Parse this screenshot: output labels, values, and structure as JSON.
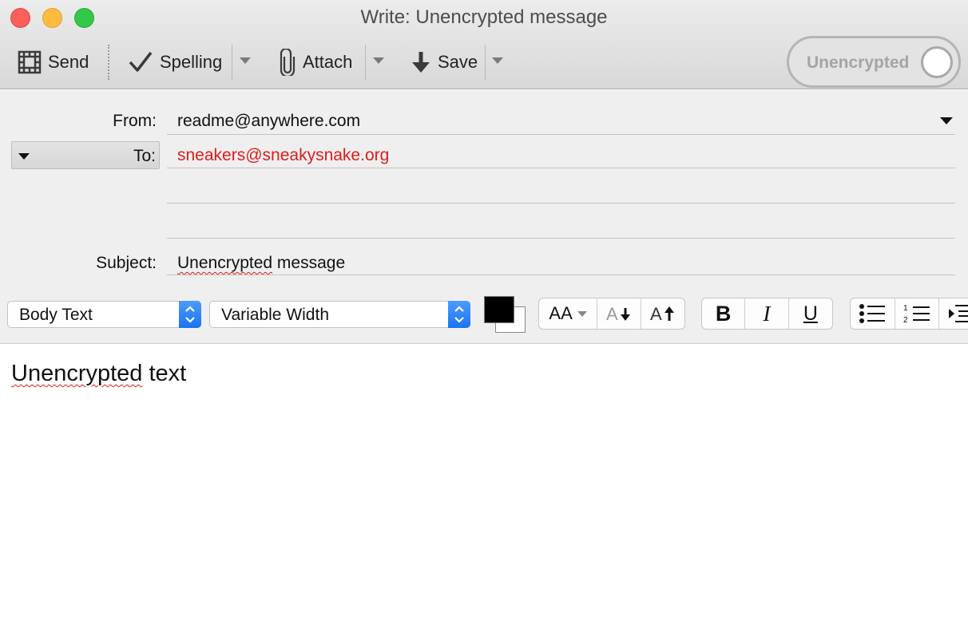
{
  "window": {
    "title": "Write: Unencrypted message"
  },
  "toolbar": {
    "send_label": "Send",
    "spelling_label": "Spelling",
    "attach_label": "Attach",
    "save_label": "Save",
    "encryption_label": "Unencrypted",
    "encryption_enabled": false
  },
  "header": {
    "from_label": "From:",
    "from_value": "readme@anywhere.com",
    "to_label": "To:",
    "to_value": "sneakers@sneakysnake.org",
    "subject_label": "Subject:",
    "subject_value_misspelled": "Unencrypted",
    "subject_value_rest": " message"
  },
  "format_bar": {
    "paragraph_style": "Body Text",
    "font": "Variable Width",
    "text_color": "#000000",
    "background_color": "#ffffff",
    "font_size_glyph": "AA",
    "bold_glyph": "B",
    "italic_glyph": "I",
    "underline_glyph": "U"
  },
  "body": {
    "text_misspelled": "Unencrypted",
    "text_rest": " text"
  },
  "colors": {
    "recipient": "#e01b1b",
    "accent_blue": "#1a73f0"
  }
}
